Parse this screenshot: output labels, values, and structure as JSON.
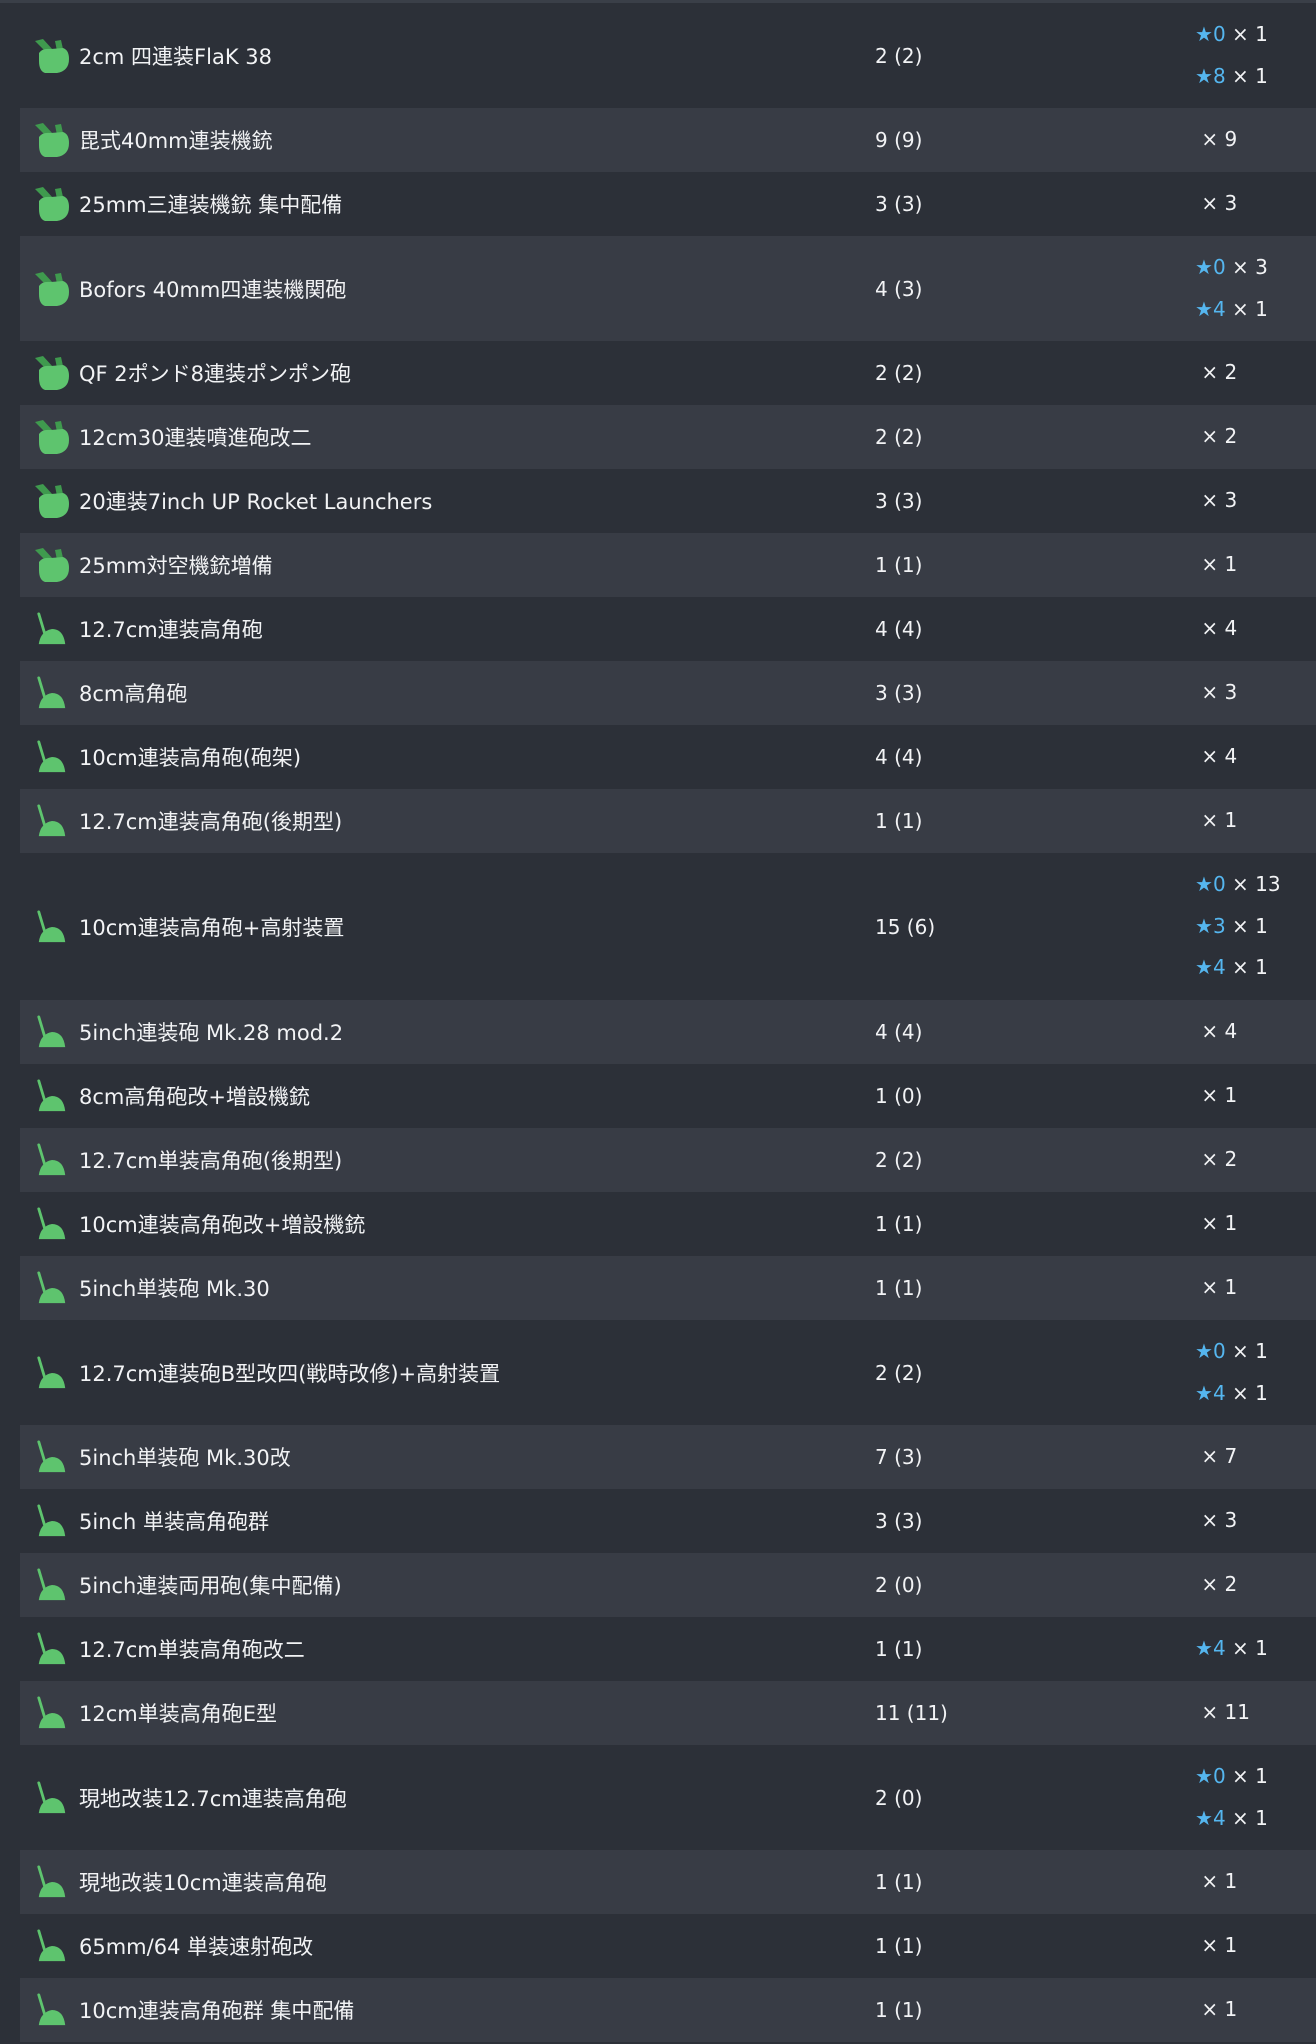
{
  "colors": {
    "background": "#2c3038",
    "row_alt": "#383c45",
    "text": "#f2f3f5",
    "star": "#55b6ef",
    "icon_green": "#5ec46e"
  },
  "icons": {
    "aa_machine_gun": "aa-machine-gun-icon",
    "high_angle_gun": "high-angle-gun-icon"
  },
  "rows": [
    {
      "name": "2cm 四連装FlaK 38",
      "count": "2 (2)",
      "icon": "mg",
      "stars": [
        {
          "star": "★",
          "level": "0",
          "qty": "× 1"
        },
        {
          "star": "★",
          "level": "8",
          "qty": "× 1"
        }
      ]
    },
    {
      "name": "毘式40mm連装機銃",
      "count": "9 (9)",
      "icon": "mg",
      "stars": [
        {
          "star": "",
          "level": "",
          "qty": "× 9"
        }
      ]
    },
    {
      "name": "25mm三連装機銃 集中配備",
      "count": "3 (3)",
      "icon": "mg",
      "stars": [
        {
          "star": "",
          "level": "",
          "qty": "× 3"
        }
      ]
    },
    {
      "name": "Bofors 40mm四連装機関砲",
      "count": "4 (3)",
      "icon": "mg",
      "stars": [
        {
          "star": "★",
          "level": "0",
          "qty": "× 3"
        },
        {
          "star": "★",
          "level": "4",
          "qty": "× 1"
        }
      ]
    },
    {
      "name": "QF 2ポンド8連装ポンポン砲",
      "count": "2 (2)",
      "icon": "mg",
      "stars": [
        {
          "star": "",
          "level": "",
          "qty": "× 2"
        }
      ]
    },
    {
      "name": "12cm30連装噴進砲改二",
      "count": "2 (2)",
      "icon": "mg",
      "stars": [
        {
          "star": "",
          "level": "",
          "qty": "× 2"
        }
      ]
    },
    {
      "name": "20連装7inch UP Rocket Launchers",
      "count": "3 (3)",
      "icon": "mg",
      "stars": [
        {
          "star": "",
          "level": "",
          "qty": "× 3"
        }
      ]
    },
    {
      "name": "25mm対空機銃増備",
      "count": "1 (1)",
      "icon": "mg",
      "stars": [
        {
          "star": "",
          "level": "",
          "qty": "× 1"
        }
      ]
    },
    {
      "name": "12.7cm連装高角砲",
      "count": "4 (4)",
      "icon": "ha",
      "stars": [
        {
          "star": "",
          "level": "",
          "qty": "× 4"
        }
      ]
    },
    {
      "name": "8cm高角砲",
      "count": "3 (3)",
      "icon": "ha",
      "stars": [
        {
          "star": "",
          "level": "",
          "qty": "× 3"
        }
      ]
    },
    {
      "name": "10cm連装高角砲(砲架)",
      "count": "4 (4)",
      "icon": "ha",
      "stars": [
        {
          "star": "",
          "level": "",
          "qty": "× 4"
        }
      ]
    },
    {
      "name": "12.7cm連装高角砲(後期型)",
      "count": "1 (1)",
      "icon": "ha",
      "stars": [
        {
          "star": "",
          "level": "",
          "qty": "× 1"
        }
      ]
    },
    {
      "name": "10cm連装高角砲+高射装置",
      "count": "15 (6)",
      "icon": "ha",
      "stars": [
        {
          "star": "★",
          "level": "0",
          "qty": "× 13"
        },
        {
          "star": "★",
          "level": "3",
          "qty": "× 1"
        },
        {
          "star": "★",
          "level": "4",
          "qty": "× 1"
        }
      ]
    },
    {
      "name": "5inch連装砲 Mk.28 mod.2",
      "count": "4 (4)",
      "icon": "ha",
      "stars": [
        {
          "star": "",
          "level": "",
          "qty": "× 4"
        }
      ]
    },
    {
      "name": "8cm高角砲改+増設機銃",
      "count": "1 (0)",
      "icon": "ha",
      "stars": [
        {
          "star": "",
          "level": "",
          "qty": "× 1"
        }
      ]
    },
    {
      "name": "12.7cm単装高角砲(後期型)",
      "count": "2 (2)",
      "icon": "ha",
      "stars": [
        {
          "star": "",
          "level": "",
          "qty": "× 2"
        }
      ]
    },
    {
      "name": "10cm連装高角砲改+増設機銃",
      "count": "1 (1)",
      "icon": "ha",
      "stars": [
        {
          "star": "",
          "level": "",
          "qty": "× 1"
        }
      ]
    },
    {
      "name": "5inch単装砲 Mk.30",
      "count": "1 (1)",
      "icon": "ha",
      "stars": [
        {
          "star": "",
          "level": "",
          "qty": "× 1"
        }
      ]
    },
    {
      "name": "12.7cm連装砲B型改四(戦時改修)+高射装置",
      "count": "2 (2)",
      "icon": "ha",
      "stars": [
        {
          "star": "★",
          "level": "0",
          "qty": "× 1"
        },
        {
          "star": "★",
          "level": "4",
          "qty": "× 1"
        }
      ]
    },
    {
      "name": "5inch単装砲 Mk.30改",
      "count": "7 (3)",
      "icon": "ha",
      "stars": [
        {
          "star": "",
          "level": "",
          "qty": "× 7"
        }
      ]
    },
    {
      "name": "5inch 単装高角砲群",
      "count": "3 (3)",
      "icon": "ha",
      "stars": [
        {
          "star": "",
          "level": "",
          "qty": "× 3"
        }
      ]
    },
    {
      "name": "5inch連装両用砲(集中配備)",
      "count": "2 (0)",
      "icon": "ha",
      "stars": [
        {
          "star": "",
          "level": "",
          "qty": "× 2"
        }
      ]
    },
    {
      "name": "12.7cm単装高角砲改二",
      "count": "1 (1)",
      "icon": "ha",
      "stars": [
        {
          "star": "★",
          "level": "4",
          "qty": "× 1"
        }
      ]
    },
    {
      "name": "12cm単装高角砲E型",
      "count": "11 (11)",
      "icon": "ha",
      "stars": [
        {
          "star": "",
          "level": "",
          "qty": "× 11"
        }
      ]
    },
    {
      "name": "現地改装12.7cm連装高角砲",
      "count": "2 (0)",
      "icon": "ha",
      "stars": [
        {
          "star": "★",
          "level": "0",
          "qty": "× 1"
        },
        {
          "star": "★",
          "level": "4",
          "qty": "× 1"
        }
      ]
    },
    {
      "name": "現地改装10cm連装高角砲",
      "count": "1 (1)",
      "icon": "ha",
      "stars": [
        {
          "star": "",
          "level": "",
          "qty": "× 1"
        }
      ]
    },
    {
      "name": "65mm/64 単装速射砲改",
      "count": "1 (1)",
      "icon": "ha",
      "stars": [
        {
          "star": "",
          "level": "",
          "qty": "× 1"
        }
      ]
    },
    {
      "name": "10cm連装高角砲群 集中配備",
      "count": "1 (1)",
      "icon": "ha",
      "stars": [
        {
          "star": "",
          "level": "",
          "qty": "× 1"
        }
      ]
    }
  ]
}
